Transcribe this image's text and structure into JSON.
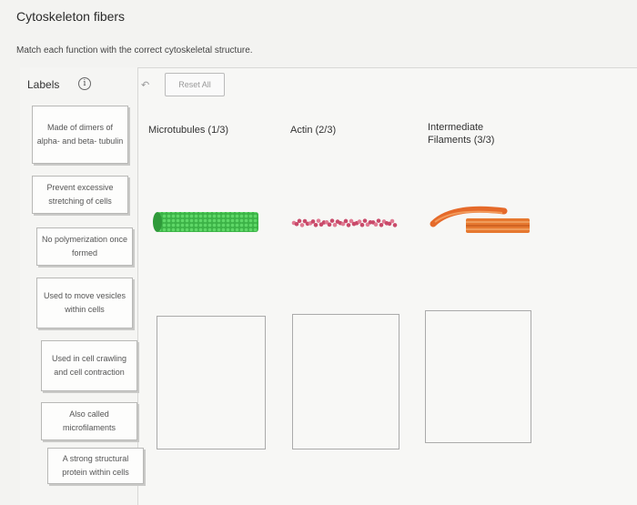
{
  "page": {
    "title": "Cytoskeleton fibers",
    "instruction": "Match each function with the correct cytoskeletal structure."
  },
  "toolbar": {
    "labels_heading": "Labels",
    "info_glyph": "i",
    "undo_glyph": "↶",
    "reset_label": "Reset All"
  },
  "labels": [
    "Made of dimers of alpha- and beta- tubulin",
    "Prevent excessive stretching of cells",
    "No polymerization once formed",
    "Used to move vesicles within cells",
    "Used in cell crawling and cell contraction",
    "Also called microfilaments",
    "A strong structural protein within cells"
  ],
  "columns": [
    {
      "heading": "Microtubules (1/3)",
      "icon": "microtubule-illustration",
      "color": "#3fbf4a"
    },
    {
      "heading": "Actin (2/3)",
      "icon": "actin-filament-illustration",
      "color": "#c94a6a"
    },
    {
      "heading": "Intermediate Filaments (3/3)",
      "icon": "intermediate-filament-illustration",
      "color": "#e8702a"
    }
  ],
  "colors": {
    "background": "#f3f3f1",
    "card_border": "#b8b8b6"
  }
}
